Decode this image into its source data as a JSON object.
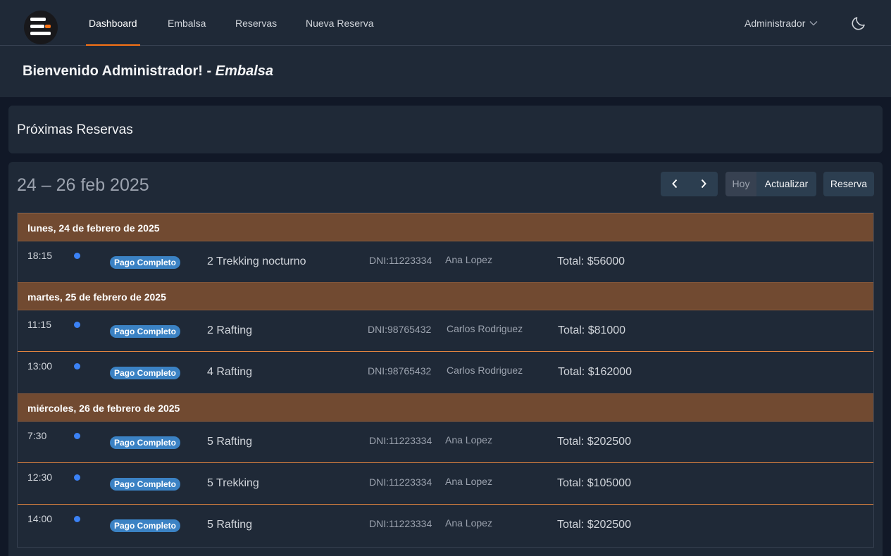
{
  "nav": {
    "links": [
      {
        "label": "Dashboard"
      },
      {
        "label": "Embalsa"
      },
      {
        "label": "Reservas"
      },
      {
        "label": "Nueva Reserva"
      }
    ],
    "user_label": "Administrador"
  },
  "welcome": {
    "text": "Bienvenido Administrador! - ",
    "place": "Embalsa"
  },
  "upcoming": {
    "title": "Próximas Reservas"
  },
  "calendar": {
    "range": "24 – 26 feb 2025",
    "buttons": {
      "today": "Hoy",
      "refresh": "Actualizar",
      "book": "Reserva"
    },
    "days": [
      {
        "label": "lunes, 24 de febrero de 2025",
        "events": [
          {
            "time": "18:15",
            "status": "Pago Completo",
            "title": "2 Trekking nocturno",
            "dni": "DNI:11223334",
            "name": "Ana Lopez",
            "total": "Total: $56000"
          }
        ]
      },
      {
        "label": "martes, 25 de febrero de 2025",
        "events": [
          {
            "time": "11:15",
            "status": "Pago Completo",
            "title": "2 Rafting",
            "dni": "DNI:98765432",
            "name": "Carlos Rodriguez",
            "total": "Total: $81000"
          },
          {
            "time": "13:00",
            "status": "Pago Completo",
            "title": "4 Rafting",
            "dni": "DNI:98765432",
            "name": "Carlos Rodriguez",
            "total": "Total: $162000"
          }
        ]
      },
      {
        "label": "miércoles, 26 de febrero de 2025",
        "events": [
          {
            "time": "7:30",
            "status": "Pago Completo",
            "title": "5 Rafting",
            "dni": "DNI:11223334",
            "name": "Ana Lopez",
            "total": "Total: $202500"
          },
          {
            "time": "12:30",
            "status": "Pago Completo",
            "title": "5 Trekking",
            "dni": "DNI:11223334",
            "name": "Ana Lopez",
            "total": "Total: $105000"
          },
          {
            "time": "14:00",
            "status": "Pago Completo",
            "title": "5 Rafting",
            "dni": "DNI:11223334",
            "name": "Ana Lopez",
            "total": "Total: $202500"
          }
        ]
      }
    ]
  },
  "colors": {
    "accent": "#f97316",
    "day_header": "#714a31",
    "badge": "#3b82c4",
    "event_dot": "#3b82f6"
  },
  "icons": {
    "logo": "menu-lines-logo",
    "user_menu": "chevron-down-icon",
    "theme": "moon-icon",
    "prev": "chevron-left-icon",
    "next": "chevron-right-icon"
  }
}
